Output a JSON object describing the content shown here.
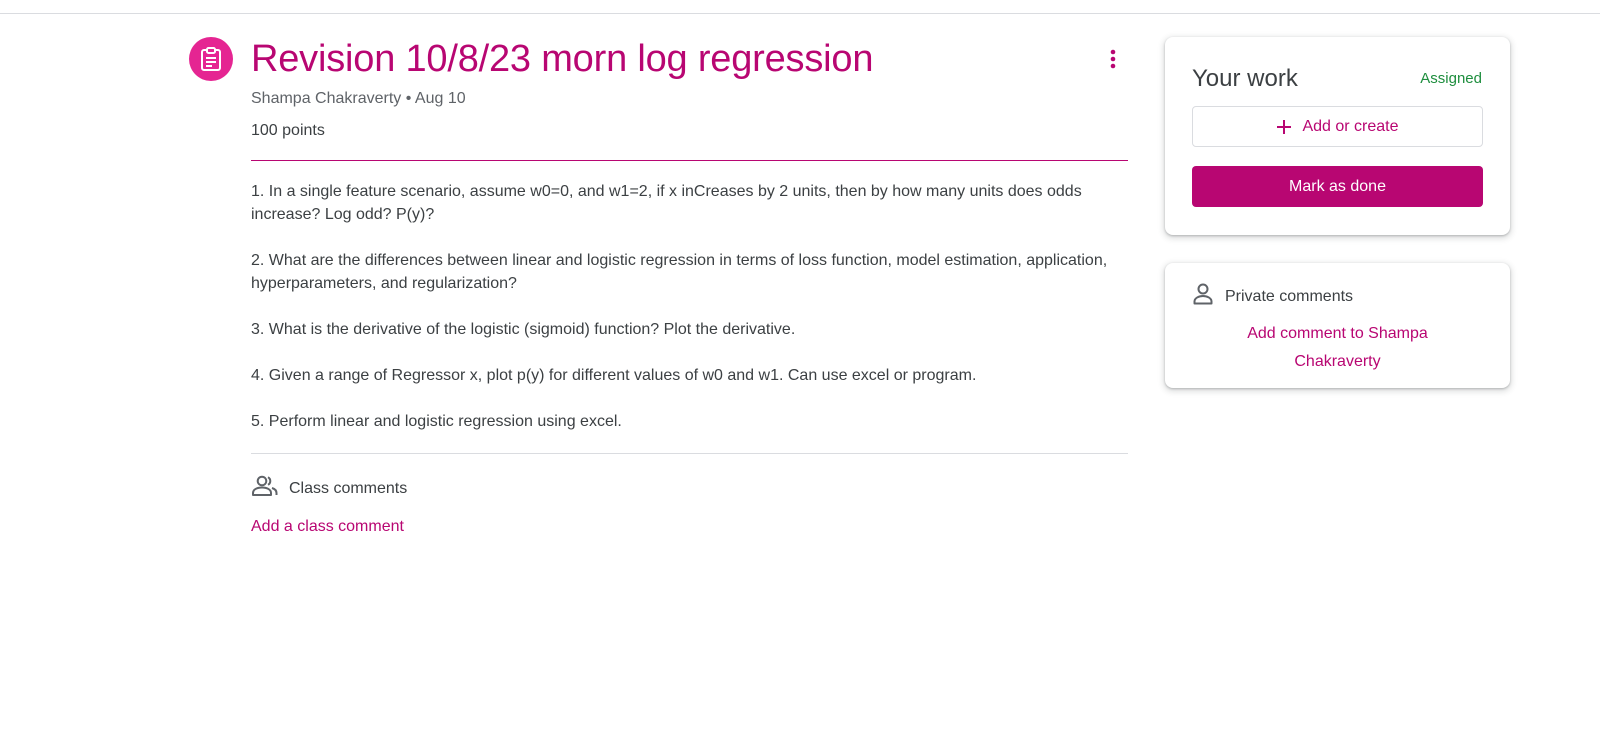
{
  "assignment": {
    "title": "Revision 10/8/23 morn log regression",
    "author": "Shampa Chakraverty",
    "separator": "•",
    "date": "Aug 10",
    "points": "100 points",
    "icon": "assignment-icon",
    "menu_icon": "more-vert-icon",
    "instructions": [
      "1. In a single feature scenario, assume w0=0, and w1=2, if x inCreases by 2 units, then by how many units does odds increase? Log odd? P(y)?",
      "2. What are the differences between linear and logistic regression in terms of loss function, model estimation, application, hyperparameters, and regularization?",
      "3. What is the derivative of the logistic (sigmoid) function? Plot the derivative.",
      "4. Given a range of Regressor x, plot p(y) for different values of w0 and w1. Can use excel or program.",
      "5. Perform linear and logistic regression using excel."
    ]
  },
  "class_comments": {
    "label": "Class comments",
    "add_label": "Add a class comment",
    "icon": "people-icon"
  },
  "your_work": {
    "title": "Your work",
    "status": "Assigned",
    "add_create_label": "Add or create",
    "add_icon": "plus-icon",
    "mark_done_label": "Mark as done"
  },
  "private_comments": {
    "label": "Private comments",
    "add_label": "Add comment to Shampa Chakraverty",
    "icon": "person-icon"
  },
  "colors": {
    "accent": "#b80672",
    "icon_bg": "#e52592",
    "status_green": "#1e8e3e",
    "text": "#3c4043",
    "muted": "#5f6368",
    "divider": "#dadce0"
  }
}
